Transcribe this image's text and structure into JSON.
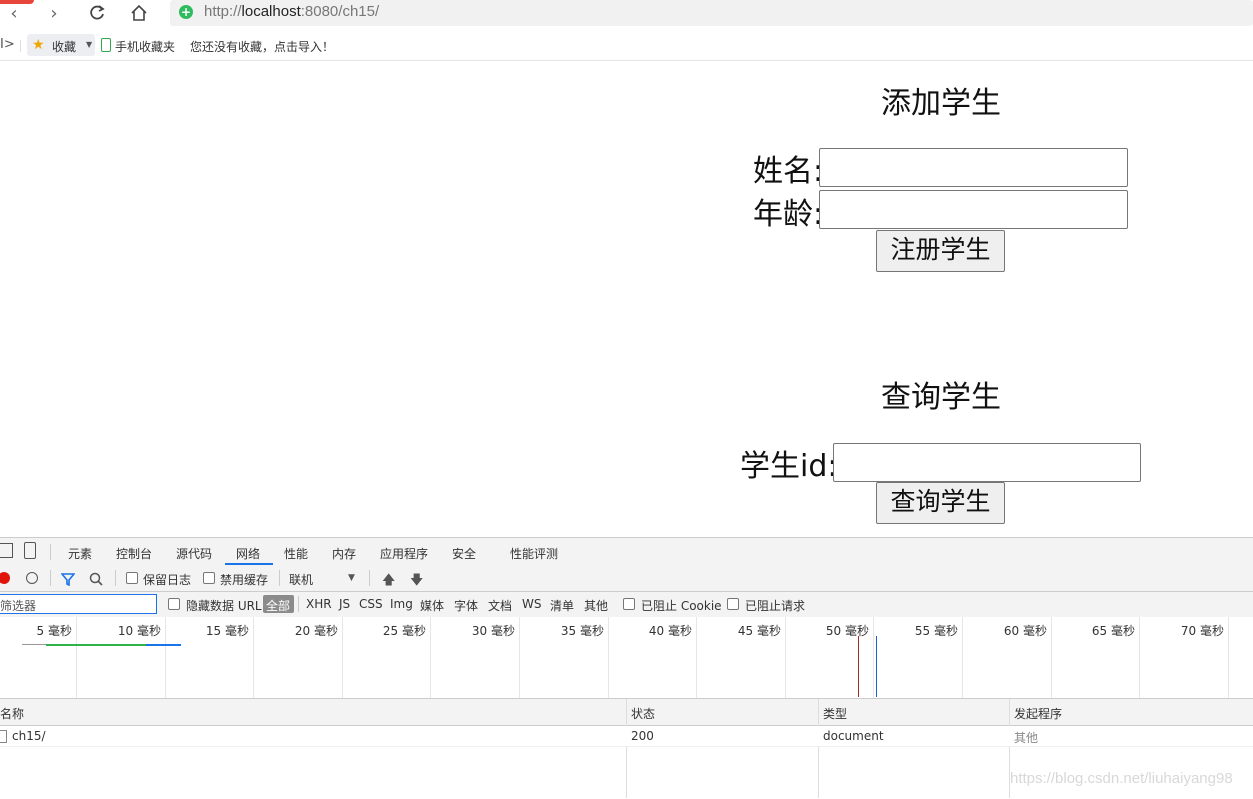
{
  "browser": {
    "url_scheme": "http://",
    "url_host": "localhost",
    "url_rest": ":8080/ch15/",
    "bookmarks": {
      "fav_label": "收藏",
      "mobile_label": "手机收藏夹",
      "import_hint": "您还没有收藏，点击导入！"
    }
  },
  "page": {
    "add_title": "添加学生",
    "name_label": "姓名:",
    "age_label": "年龄:",
    "register_button": "注册学生",
    "query_title": "查询学生",
    "id_label": "学生id:",
    "query_button": "查询学生"
  },
  "devtools": {
    "tabs": [
      "元素",
      "控制台",
      "源代码",
      "网络",
      "性能",
      "内存",
      "应用程序",
      "安全",
      "性能评测"
    ],
    "active_tab": "网络",
    "toolbar": {
      "preserve_log": "保留日志",
      "disable_cache": "禁用缓存",
      "throttle": "联机"
    },
    "filter": {
      "placeholder": "筛选器",
      "hide_data_url": "隐藏数据 URL",
      "types": [
        "全部",
        "XHR",
        "JS",
        "CSS",
        "Img",
        "媒体",
        "字体",
        "文档",
        "WS",
        "清单",
        "其他"
      ],
      "blocked_cookies": "已阻止 Cookie",
      "blocked_requests": "已阻止请求"
    },
    "timeline_ticks": [
      "5 毫秒",
      "10 毫秒",
      "15 毫秒",
      "20 毫秒",
      "25 毫秒",
      "30 毫秒",
      "35 毫秒",
      "40 毫秒",
      "45 毫秒",
      "50 毫秒",
      "55 毫秒",
      "60 毫秒",
      "65 毫秒",
      "70 毫秒"
    ],
    "table": {
      "headers": [
        "名称",
        "状态",
        "类型",
        "发起程序"
      ],
      "rows": [
        {
          "name": "ch15/",
          "status": "200",
          "type": "document",
          "initiator": "其他"
        }
      ]
    }
  },
  "watermark": "https://blog.csdn.net/liuhaiyang98"
}
